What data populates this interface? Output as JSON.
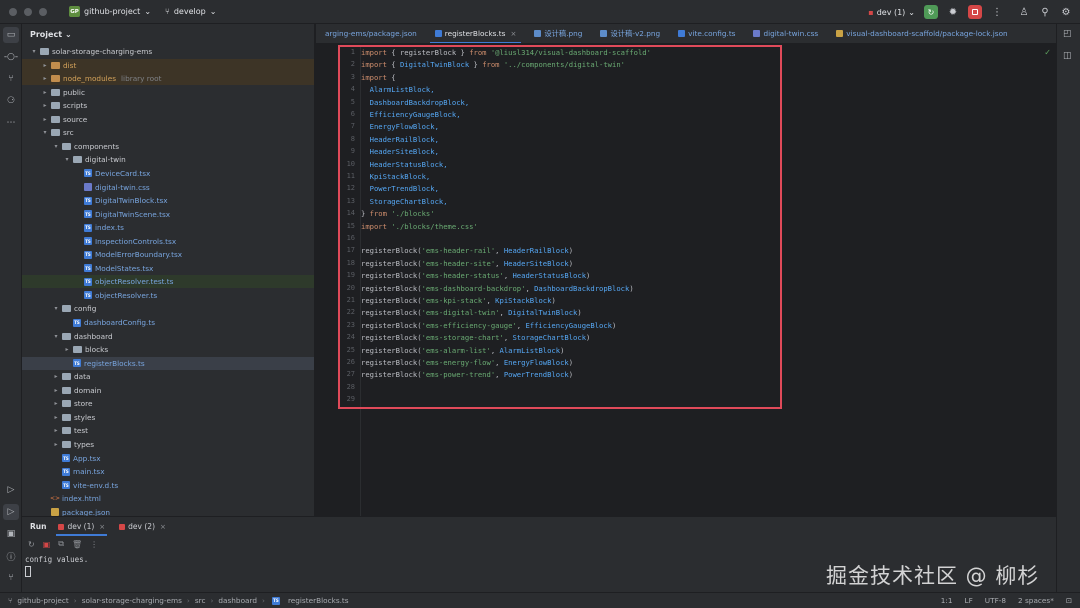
{
  "titlebar": {
    "project_badge": "GP",
    "project_name": "github-project",
    "branch": "develop",
    "run_config": "dev (1)"
  },
  "colors": {
    "accent": "#3f7bd6",
    "run_green": "#4f9a57",
    "stop_red": "#d54747",
    "highlight_box": "#e04a5a"
  },
  "project_panel": {
    "title": "Project",
    "rows": [
      {
        "label": "solar-storage-charging-ems",
        "indent": 1,
        "type": "folder",
        "arrow": "v"
      },
      {
        "label": "dist",
        "indent": 2,
        "type": "folder-orange",
        "arrow": ">",
        "style": "excluded",
        "color": "orange"
      },
      {
        "label": "node_modules",
        "hint": "library root",
        "indent": 2,
        "type": "folder-orange",
        "arrow": ">",
        "style": "excluded",
        "color": "orange"
      },
      {
        "label": "public",
        "indent": 2,
        "type": "folder",
        "arrow": ">"
      },
      {
        "label": "scripts",
        "indent": 2,
        "type": "folder",
        "arrow": ">"
      },
      {
        "label": "source",
        "indent": 2,
        "type": "folder",
        "arrow": ">"
      },
      {
        "label": "src",
        "indent": 2,
        "type": "folder",
        "arrow": "v"
      },
      {
        "label": "components",
        "indent": 3,
        "type": "folder",
        "arrow": "v"
      },
      {
        "label": "digital-twin",
        "indent": 4,
        "type": "folder",
        "arrow": "v"
      },
      {
        "label": "DeviceCard.tsx",
        "indent": 5,
        "type": "ts",
        "color": "blue"
      },
      {
        "label": "digital-twin.css",
        "indent": 5,
        "type": "css",
        "color": "blue"
      },
      {
        "label": "DigitalTwinBlock.tsx",
        "indent": 5,
        "type": "ts",
        "color": "blue"
      },
      {
        "label": "DigitalTwinScene.tsx",
        "indent": 5,
        "type": "ts",
        "color": "blue"
      },
      {
        "label": "index.ts",
        "indent": 5,
        "type": "ts",
        "color": "blue"
      },
      {
        "label": "InspectionControls.tsx",
        "indent": 5,
        "type": "ts",
        "color": "blue"
      },
      {
        "label": "ModelErrorBoundary.tsx",
        "indent": 5,
        "type": "ts",
        "color": "blue"
      },
      {
        "label": "ModelStates.tsx",
        "indent": 5,
        "type": "ts",
        "color": "blue"
      },
      {
        "label": "objectResolver.test.ts",
        "indent": 5,
        "type": "ts",
        "color": "blue",
        "style": "modified-row"
      },
      {
        "label": "objectResolver.ts",
        "indent": 5,
        "type": "ts",
        "color": "blue"
      },
      {
        "label": "config",
        "indent": 3,
        "type": "folder",
        "arrow": "v"
      },
      {
        "label": "dashboardConfig.ts",
        "indent": 4,
        "type": "ts",
        "color": "blue"
      },
      {
        "label": "dashboard",
        "indent": 3,
        "type": "folder",
        "arrow": "v"
      },
      {
        "label": "blocks",
        "indent": 4,
        "type": "folder",
        "arrow": ">"
      },
      {
        "label": "registerBlocks.ts",
        "indent": 4,
        "type": "ts",
        "color": "blue",
        "style": "selected"
      },
      {
        "label": "data",
        "indent": 3,
        "type": "folder",
        "arrow": ">"
      },
      {
        "label": "domain",
        "indent": 3,
        "type": "folder",
        "arrow": ">"
      },
      {
        "label": "store",
        "indent": 3,
        "type": "folder",
        "arrow": ">"
      },
      {
        "label": "styles",
        "indent": 3,
        "type": "folder",
        "arrow": ">"
      },
      {
        "label": "test",
        "indent": 3,
        "type": "folder",
        "arrow": ">"
      },
      {
        "label": "types",
        "indent": 3,
        "type": "folder",
        "arrow": ">"
      },
      {
        "label": "App.tsx",
        "indent": 3,
        "type": "ts",
        "color": "blue"
      },
      {
        "label": "main.tsx",
        "indent": 3,
        "type": "ts",
        "color": "blue"
      },
      {
        "label": "vite-env.d.ts",
        "indent": 3,
        "type": "ts",
        "color": "blue"
      },
      {
        "label": "index.html",
        "indent": 2,
        "type": "html",
        "color": "blue"
      },
      {
        "label": "package.json",
        "indent": 2,
        "type": "json",
        "color": "blue"
      }
    ]
  },
  "tabs": [
    {
      "label": "arging-ems/package.json",
      "icon": "none"
    },
    {
      "label": "registerBlocks.ts",
      "icon": "ts",
      "active": true,
      "closable": true
    },
    {
      "label": "设计稿.png",
      "icon": "img"
    },
    {
      "label": "设计稿-v2.png",
      "icon": "img"
    },
    {
      "label": "vite.config.ts",
      "icon": "ts"
    },
    {
      "label": "digital-twin.css",
      "icon": "css"
    },
    {
      "label": "visual-dashboard-scaffold/package-lock.json",
      "icon": "json"
    }
  ],
  "editor": {
    "line_numbers": [
      "1",
      "2",
      "3",
      "4",
      "5",
      "6",
      "7",
      "8",
      "9",
      "10",
      "11",
      "12",
      "13",
      "14",
      "15",
      "16",
      "17",
      "18",
      "19",
      "20",
      "21",
      "22",
      "23",
      "24",
      "25",
      "26",
      "27",
      "28",
      "29"
    ],
    "lines": [
      [
        {
          "t": "import ",
          "c": "kw"
        },
        {
          "t": "{ registerBlock } ",
          "c": "fn"
        },
        {
          "t": "from ",
          "c": "kw"
        },
        {
          "t": "'@liusl314/visual-dashboard-scaffold'",
          "c": "str"
        }
      ],
      [
        {
          "t": "import ",
          "c": "kw"
        },
        {
          "t": "{ ",
          "c": "fn"
        },
        {
          "t": "DigitalTwinBlock",
          "c": "id"
        },
        {
          "t": " } ",
          "c": "fn"
        },
        {
          "t": "from ",
          "c": "kw"
        },
        {
          "t": "'../components/digital-twin'",
          "c": "str"
        }
      ],
      [
        {
          "t": "import ",
          "c": "kw"
        },
        {
          "t": "{",
          "c": "fn"
        }
      ],
      [
        {
          "t": "  AlarmListBlock,",
          "c": "id"
        }
      ],
      [
        {
          "t": "  DashboardBackdropBlock,",
          "c": "id"
        }
      ],
      [
        {
          "t": "  EfficiencyGaugeBlock,",
          "c": "id"
        }
      ],
      [
        {
          "t": "  EnergyFlowBlock,",
          "c": "id"
        }
      ],
      [
        {
          "t": "  HeaderRailBlock,",
          "c": "id"
        }
      ],
      [
        {
          "t": "  HeaderSiteBlock,",
          "c": "id"
        }
      ],
      [
        {
          "t": "  HeaderStatusBlock,",
          "c": "id"
        }
      ],
      [
        {
          "t": "  KpiStackBlock,",
          "c": "id"
        }
      ],
      [
        {
          "t": "  PowerTrendBlock,",
          "c": "id"
        }
      ],
      [
        {
          "t": "  StorageChartBlock,",
          "c": "id"
        }
      ],
      [
        {
          "t": "} ",
          "c": "fn"
        },
        {
          "t": "from ",
          "c": "kw"
        },
        {
          "t": "'./blocks'",
          "c": "str"
        }
      ],
      [
        {
          "t": "import ",
          "c": "kw"
        },
        {
          "t": "'./blocks/theme.css'",
          "c": "str"
        }
      ],
      [],
      [
        {
          "t": "registerBlock(",
          "c": "fn"
        },
        {
          "t": "'ems-header-rail'",
          "c": "str"
        },
        {
          "t": ", ",
          "c": "fn"
        },
        {
          "t": "HeaderRailBlock",
          "c": "id"
        },
        {
          "t": ")",
          "c": "fn"
        }
      ],
      [
        {
          "t": "registerBlock(",
          "c": "fn"
        },
        {
          "t": "'ems-header-site'",
          "c": "str"
        },
        {
          "t": ", ",
          "c": "fn"
        },
        {
          "t": "HeaderSiteBlock",
          "c": "id"
        },
        {
          "t": ")",
          "c": "fn"
        }
      ],
      [
        {
          "t": "registerBlock(",
          "c": "fn"
        },
        {
          "t": "'ems-header-status'",
          "c": "str"
        },
        {
          "t": ", ",
          "c": "fn"
        },
        {
          "t": "HeaderStatusBlock",
          "c": "id"
        },
        {
          "t": ")",
          "c": "fn"
        }
      ],
      [
        {
          "t": "registerBlock(",
          "c": "fn"
        },
        {
          "t": "'ems-dashboard-backdrop'",
          "c": "str"
        },
        {
          "t": ", ",
          "c": "fn"
        },
        {
          "t": "DashboardBackdropBlock",
          "c": "id"
        },
        {
          "t": ")",
          "c": "fn"
        }
      ],
      [
        {
          "t": "registerBlock(",
          "c": "fn"
        },
        {
          "t": "'ems-kpi-stack'",
          "c": "str"
        },
        {
          "t": ", ",
          "c": "fn"
        },
        {
          "t": "KpiStackBlock",
          "c": "id"
        },
        {
          "t": ")",
          "c": "fn"
        }
      ],
      [
        {
          "t": "registerBlock(",
          "c": "fn"
        },
        {
          "t": "'ems-digital-twin'",
          "c": "str"
        },
        {
          "t": ", ",
          "c": "fn"
        },
        {
          "t": "DigitalTwinBlock",
          "c": "id"
        },
        {
          "t": ")",
          "c": "fn"
        }
      ],
      [
        {
          "t": "registerBlock(",
          "c": "fn"
        },
        {
          "t": "'ems-efficiency-gauge'",
          "c": "str"
        },
        {
          "t": ", ",
          "c": "fn"
        },
        {
          "t": "EfficiencyGaugeBlock",
          "c": "id"
        },
        {
          "t": ")",
          "c": "fn"
        }
      ],
      [
        {
          "t": "registerBlock(",
          "c": "fn"
        },
        {
          "t": "'ems-storage-chart'",
          "c": "str"
        },
        {
          "t": ", ",
          "c": "fn"
        },
        {
          "t": "StorageChartBlock",
          "c": "id"
        },
        {
          "t": ")",
          "c": "fn"
        }
      ],
      [
        {
          "t": "registerBlock(",
          "c": "fn"
        },
        {
          "t": "'ems-alarm-list'",
          "c": "str"
        },
        {
          "t": ", ",
          "c": "fn"
        },
        {
          "t": "AlarmListBlock",
          "c": "id"
        },
        {
          "t": ")",
          "c": "fn"
        }
      ],
      [
        {
          "t": "registerBlock(",
          "c": "fn"
        },
        {
          "t": "'ems-energy-flow'",
          "c": "str"
        },
        {
          "t": ", ",
          "c": "fn"
        },
        {
          "t": "EnergyFlowBlock",
          "c": "id"
        },
        {
          "t": ")",
          "c": "fn"
        }
      ],
      [
        {
          "t": "registerBlock(",
          "c": "fn"
        },
        {
          "t": "'ems-power-trend'",
          "c": "str"
        },
        {
          "t": ", ",
          "c": "fn"
        },
        {
          "t": "PowerTrendBlock",
          "c": "id"
        },
        {
          "t": ")",
          "c": "fn"
        }
      ],
      [],
      []
    ]
  },
  "run_panel": {
    "title": "Run",
    "tabs": [
      "dev (1)",
      "dev (2)"
    ],
    "console_output": "config values."
  },
  "status_bar": {
    "breadcrumbs": [
      "github-project",
      "solar-storage-charging-ems",
      "src",
      "dashboard",
      "registerBlocks.ts"
    ],
    "position": "1:1",
    "line_ending": "LF",
    "encoding": "UTF-8",
    "indent": "2 spaces*"
  },
  "watermark": "掘金技术社区 @ 柳杉"
}
